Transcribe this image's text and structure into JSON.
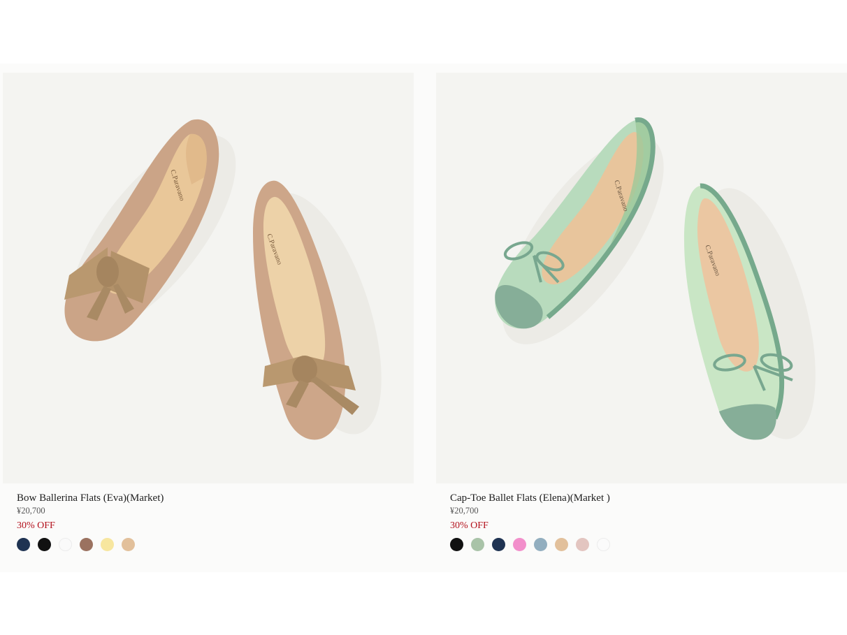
{
  "products": [
    {
      "title": "Bow Ballerina Flats (Eva)(Market)",
      "price": "¥20,700",
      "discount": "30% OFF",
      "brand_mark": "C.Paravano",
      "swatches": [
        {
          "name": "navy",
          "color": "#1f3352"
        },
        {
          "name": "black",
          "color": "#111111"
        },
        {
          "name": "white",
          "color": "#fafafa"
        },
        {
          "name": "brown",
          "color": "#9b7260"
        },
        {
          "name": "yellow",
          "color": "#f7e69f"
        },
        {
          "name": "beige",
          "color": "#e2c09b"
        }
      ]
    },
    {
      "title": "Cap-Toe Ballet Flats (Elena)(Market )",
      "price": "¥20,700",
      "discount": "30% OFF",
      "brand_mark": "C.Paravano",
      "swatches": [
        {
          "name": "black",
          "color": "#111111"
        },
        {
          "name": "sage",
          "color": "#a9c3a8"
        },
        {
          "name": "navy",
          "color": "#1f3352"
        },
        {
          "name": "pink",
          "color": "#f28fcb"
        },
        {
          "name": "light-blue",
          "color": "#92aebf"
        },
        {
          "name": "beige",
          "color": "#e2c09b"
        },
        {
          "name": "blush",
          "color": "#e3c5c0"
        },
        {
          "name": "white",
          "color": "#fbfbfb"
        }
      ]
    }
  ],
  "colors": {
    "discount": "#b3111c",
    "image_bg": "#f4f4f1"
  }
}
